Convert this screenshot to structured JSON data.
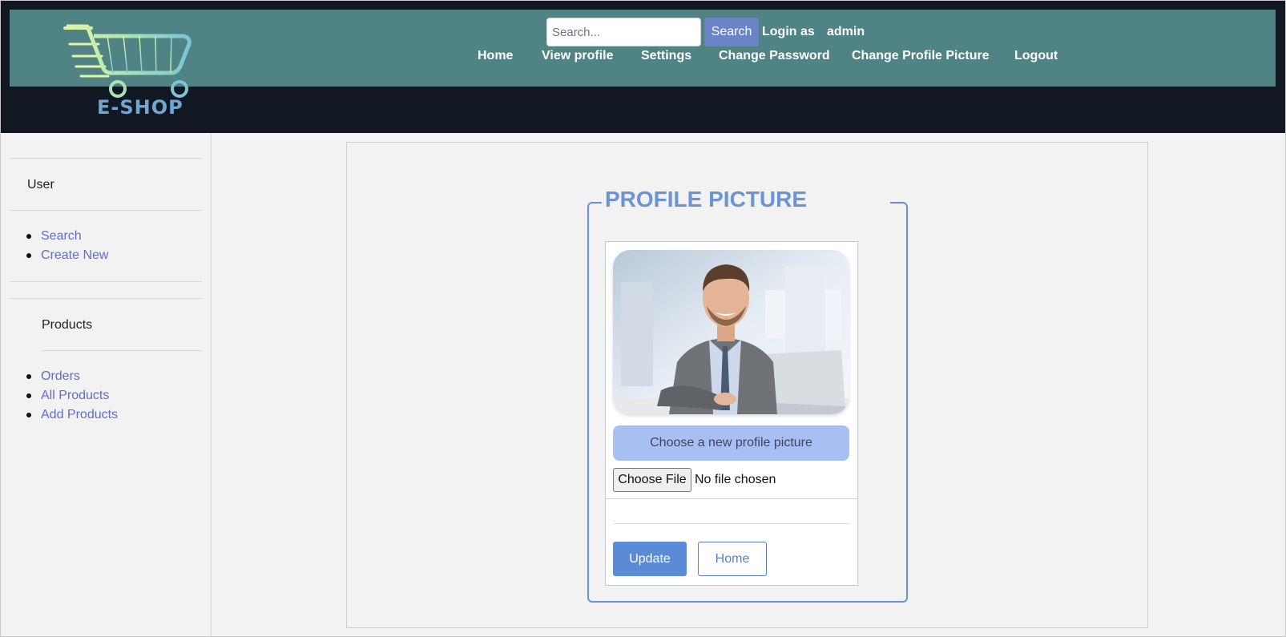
{
  "header": {
    "logo_text": "E-SHOP",
    "search": {
      "placeholder": "Search...",
      "button_label": "Search"
    },
    "login_prefix": "Login as",
    "username": "admin",
    "nav": [
      "Home",
      "View profile",
      "Settings",
      "Change Password",
      "Change Profile Picture",
      "Logout"
    ]
  },
  "sidebar": {
    "user_label": "User",
    "user_links": [
      "Search",
      "Create New"
    ],
    "products_label": "Products",
    "product_links": [
      "Orders",
      "All Products",
      "Add Products"
    ]
  },
  "main": {
    "legend": "PROFILE PICTURE",
    "choose_label": "Choose a new profile picture",
    "file_button": "Choose File",
    "file_status": "No file chosen",
    "update_label": "Update",
    "home_label": "Home"
  },
  "colors": {
    "header_bg": "#111821",
    "nav_bar": "#508383",
    "accent": "#6b8fd0",
    "link": "#5e6ec9"
  }
}
